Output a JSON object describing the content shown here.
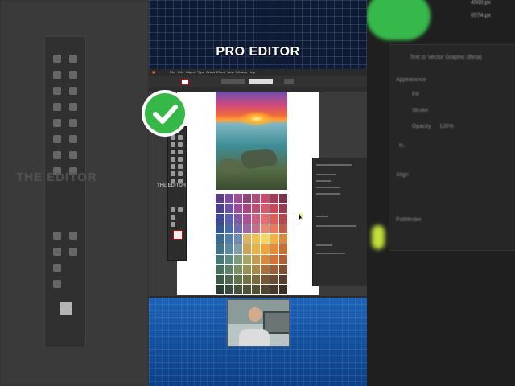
{
  "banner": {
    "title": "PRO EDITOR"
  },
  "watermark": {
    "left": "THE EDITOR",
    "center": "THE EDITOR"
  },
  "menu": [
    "File",
    "Edit",
    "Object",
    "Type",
    "Select",
    "Effect",
    "View",
    "Window",
    "Help"
  ],
  "right_background_panel": {
    "header": "Text to Vector Graphic (Beta)",
    "sections": [
      "Appearance",
      "Fill",
      "Stroke",
      "Opacity",
      "Align",
      "Pathfinder"
    ],
    "opacity_value": "100%",
    "size_values": [
      "4500 px",
      "6574 px"
    ],
    "fx_label": "fx."
  },
  "colors": {
    "check_green": "#35b847",
    "banner_blue": "#1d62b6"
  },
  "swatch_colors": [
    "#5b3f85",
    "#7e4ca0",
    "#a04d94",
    "#8a4675",
    "#b24a78",
    "#c84c6b",
    "#a03e58",
    "#7a314a",
    "#4a3e8e",
    "#6c52a6",
    "#9b4c9e",
    "#a6467e",
    "#c04d70",
    "#d9596a",
    "#c94858",
    "#9a3c4f",
    "#3c4a96",
    "#5a5eaf",
    "#8157a8",
    "#a75392",
    "#cf5c83",
    "#e36e6d",
    "#dd5f59",
    "#b6484d",
    "#34558f",
    "#4b6aa8",
    "#6e6db4",
    "#9c66a6",
    "#c56f8c",
    "#e88a73",
    "#e97957",
    "#c45a48",
    "#3a6a8e",
    "#4f7fa8",
    "#6d8db4",
    "#d9b26a",
    "#f0c24e",
    "#f6d86a",
    "#f2b243",
    "#d98a3e",
    "#41728a",
    "#5b8aa0",
    "#7fa0a8",
    "#c9a45a",
    "#eab346",
    "#f2a23d",
    "#e88b38",
    "#c86d35",
    "#467a78",
    "#5d8c82",
    "#7d9c7c",
    "#a5a56a",
    "#c49c4e",
    "#d88a3e",
    "#d2743a",
    "#b05e35",
    "#48705e",
    "#5c8068",
    "#7a8f64",
    "#939458",
    "#a58a4a",
    "#a8733e",
    "#99613a",
    "#7e5034",
    "#3e5a48",
    "#4e6852",
    "#62744c",
    "#707444",
    "#7a6a3e",
    "#765a38",
    "#6a4c34",
    "#553c2e",
    "#2c3d38",
    "#384a3e",
    "#45523c",
    "#4e5238",
    "#545034",
    "#4e4430",
    "#44392c",
    "#382e26"
  ]
}
